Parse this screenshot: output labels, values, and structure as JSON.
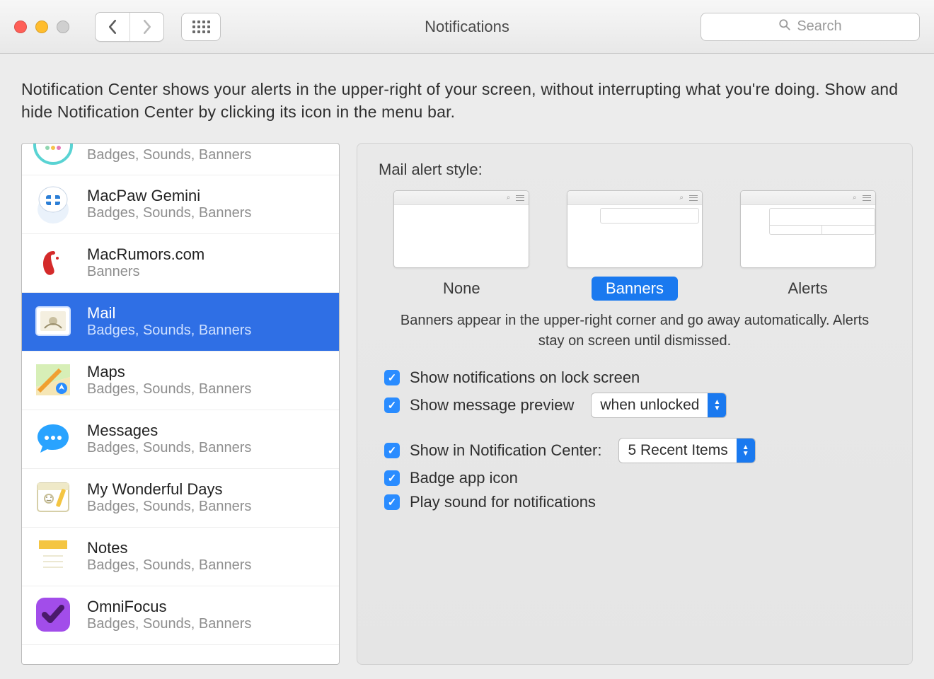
{
  "window": {
    "title": "Notifications",
    "search_placeholder": "Search"
  },
  "description": "Notification Center shows your alerts in the upper-right of your screen, without interrupting what you're doing. Show and hide Notification Center by clicking its icon in the menu bar.",
  "apps": [
    {
      "name": "",
      "sub": "Badges, Sounds, Banners",
      "icon": "circle-dots",
      "partial": true
    },
    {
      "name": "MacPaw Gemini",
      "sub": "Badges, Sounds, Banners",
      "icon": "gemini"
    },
    {
      "name": "MacRumors.com",
      "sub": "Banners",
      "icon": "macrumors"
    },
    {
      "name": "Mail",
      "sub": "Badges, Sounds, Banners",
      "icon": "mail",
      "selected": true
    },
    {
      "name": "Maps",
      "sub": "Badges, Sounds, Banners",
      "icon": "maps"
    },
    {
      "name": "Messages",
      "sub": "Badges, Sounds, Banners",
      "icon": "messages"
    },
    {
      "name": "My Wonderful Days",
      "sub": "Badges, Sounds, Banners",
      "icon": "diary"
    },
    {
      "name": "Notes",
      "sub": "Badges, Sounds, Banners",
      "icon": "notes"
    },
    {
      "name": "OmniFocus",
      "sub": "Badges, Sounds, Banners",
      "icon": "omnifocus"
    }
  ],
  "detail": {
    "heading": "Mail alert style:",
    "styles": [
      {
        "label": "None",
        "kind": "none"
      },
      {
        "label": "Banners",
        "kind": "banner",
        "active": true
      },
      {
        "label": "Alerts",
        "kind": "alert"
      }
    ],
    "help": "Banners appear in the upper-right corner and go away automatically. Alerts stay on screen until dismissed.",
    "options": {
      "lock_screen": "Show notifications on lock screen",
      "message_preview": "Show message preview",
      "message_preview_value": "when unlocked",
      "notif_center": "Show in Notification Center:",
      "notif_center_value": "5 Recent Items",
      "badge": "Badge app icon",
      "sound": "Play sound for notifications"
    }
  }
}
